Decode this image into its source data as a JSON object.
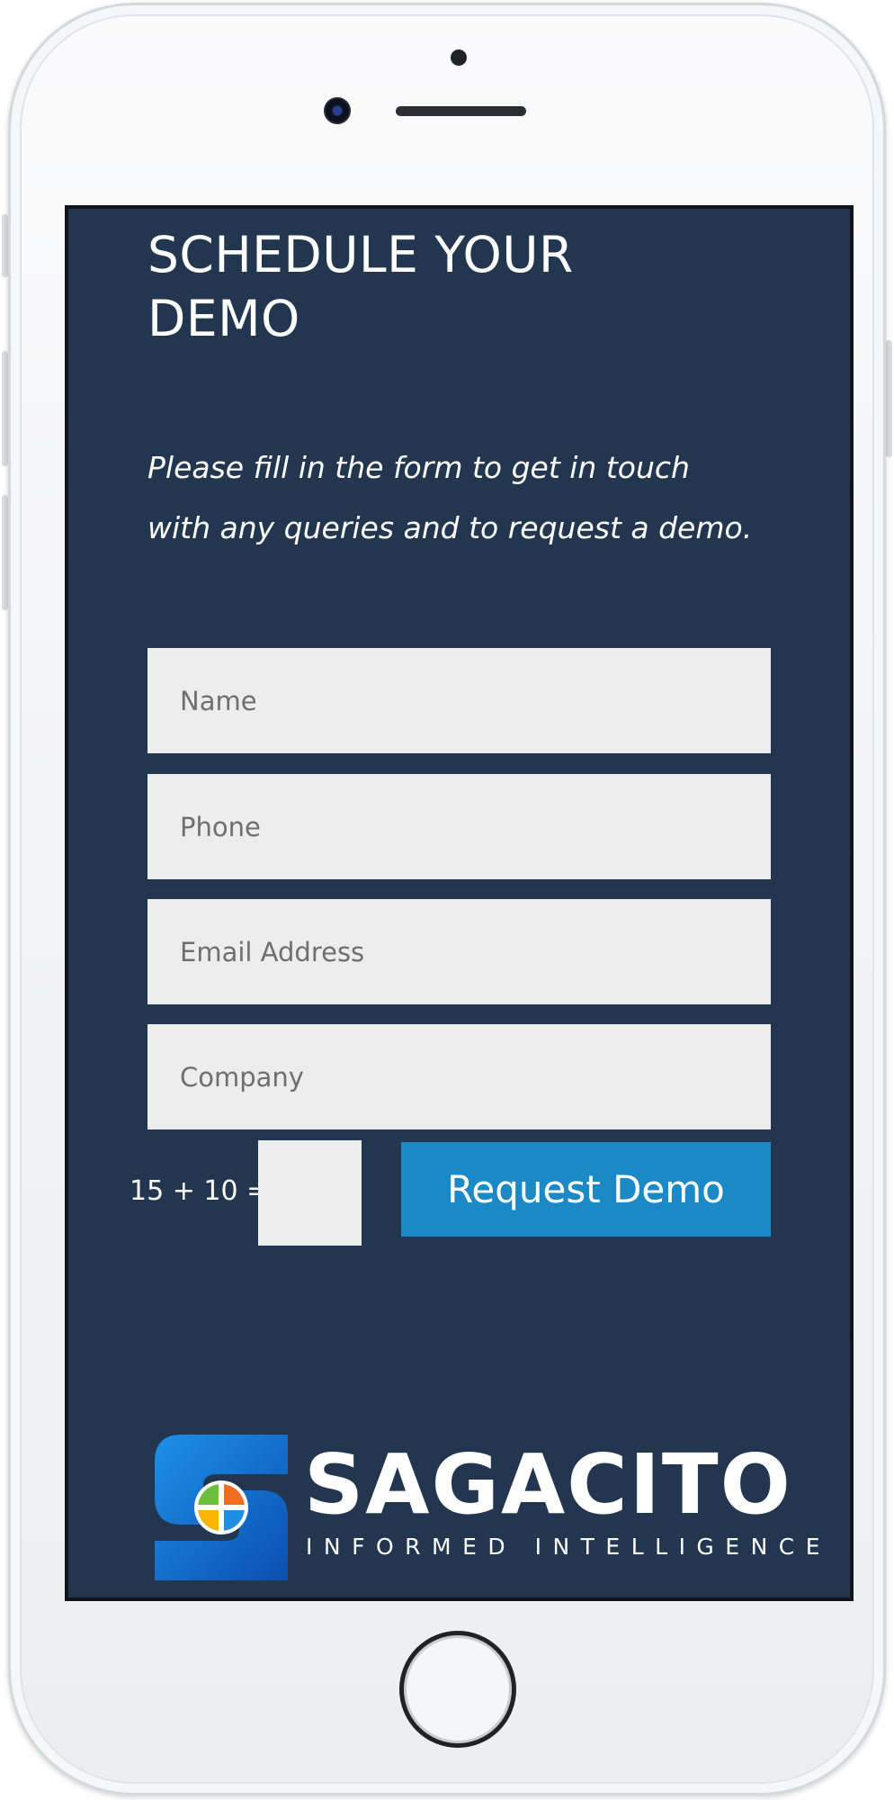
{
  "page": {
    "heading": "SCHEDULE YOUR DEMO",
    "intro": "Please fill in the form to get in touch with any queries and to request a demo."
  },
  "form": {
    "name_placeholder": "Name",
    "phone_placeholder": "Phone",
    "email_placeholder": "Email Address",
    "company_placeholder": "Company",
    "captcha_question": "15 + 10 =",
    "captcha_value": "",
    "submit_label": "Request Demo"
  },
  "logo": {
    "name": "SAGACITO",
    "tagline": "INFORMED INTELLIGENCE"
  },
  "colors": {
    "screen_background": "#233650",
    "input_background": "#ededed",
    "button": "#1b89c6",
    "text": "#ffffff"
  },
  "icons": {
    "logo_mark": "sagacito-s-mark-icon",
    "camera": "front-camera-icon",
    "home": "home-button-icon"
  }
}
